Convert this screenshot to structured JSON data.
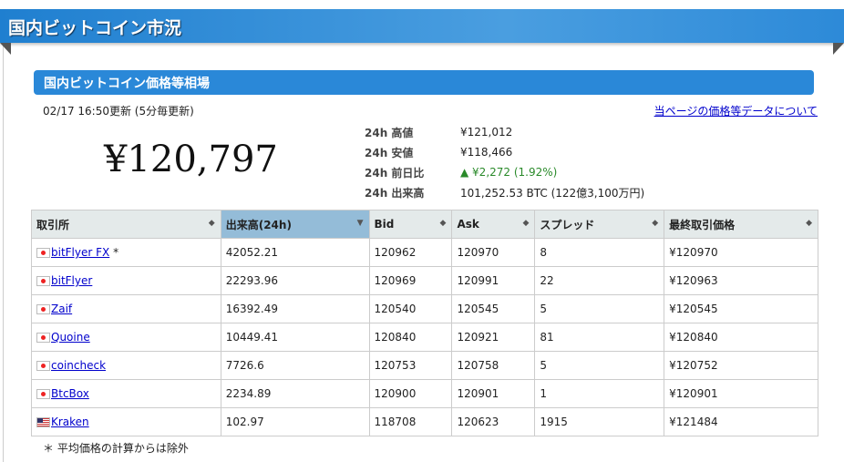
{
  "header": {
    "title": "国内ビットコイン市況"
  },
  "section": {
    "title": "国内ビットコイン価格等相場",
    "updated": "02/17 16:50更新 (5分毎更新)",
    "about_link": "当ページの価格等データについて"
  },
  "price": "¥120,797",
  "stats": [
    {
      "label": "24h 高値",
      "value": "¥121,012"
    },
    {
      "label": "24h 安値",
      "value": "¥118,466"
    },
    {
      "label": "24h 前日比",
      "value": "▲ ¥2,272 (1.92%)"
    },
    {
      "label": "24h 出来高",
      "value": "101,252.53 BTC (122億3,100万円)"
    }
  ],
  "colors": {
    "accent": "#2a88d8",
    "up": "#2a8a2a"
  },
  "table": {
    "headers": [
      "取引所",
      "出来高(24h)",
      "Bid",
      "Ask",
      "スプレッド",
      "最終取引価格"
    ],
    "rows": [
      {
        "name": "bitFlyer FX",
        "mark": "*",
        "flag": "jp",
        "cells": [
          "42052.21",
          "120962",
          "120970",
          "8",
          "¥120970"
        ]
      },
      {
        "name": "bitFlyer",
        "mark": "",
        "flag": "jp",
        "cells": [
          "22293.96",
          "120969",
          "120991",
          "22",
          "¥120963"
        ]
      },
      {
        "name": "Zaif",
        "mark": "",
        "flag": "jp",
        "cells": [
          "16392.49",
          "120540",
          "120545",
          "5",
          "¥120545"
        ]
      },
      {
        "name": "Quoine",
        "mark": "",
        "flag": "jp",
        "cells": [
          "10449.41",
          "120840",
          "120921",
          "81",
          "¥120840"
        ]
      },
      {
        "name": "coincheck",
        "mark": "",
        "flag": "jp",
        "cells": [
          "7726.6",
          "120753",
          "120758",
          "5",
          "¥120752"
        ]
      },
      {
        "name": "BtcBox",
        "mark": "",
        "flag": "jp",
        "cells": [
          "2234.89",
          "120900",
          "120901",
          "1",
          "¥120901"
        ]
      },
      {
        "name": "Kraken",
        "mark": "",
        "flag": "us",
        "cells": [
          "102.97",
          "118708",
          "120623",
          "1915",
          "¥121484"
        ]
      }
    ]
  },
  "footnote": "＊ 平均価格の計算からは除外"
}
